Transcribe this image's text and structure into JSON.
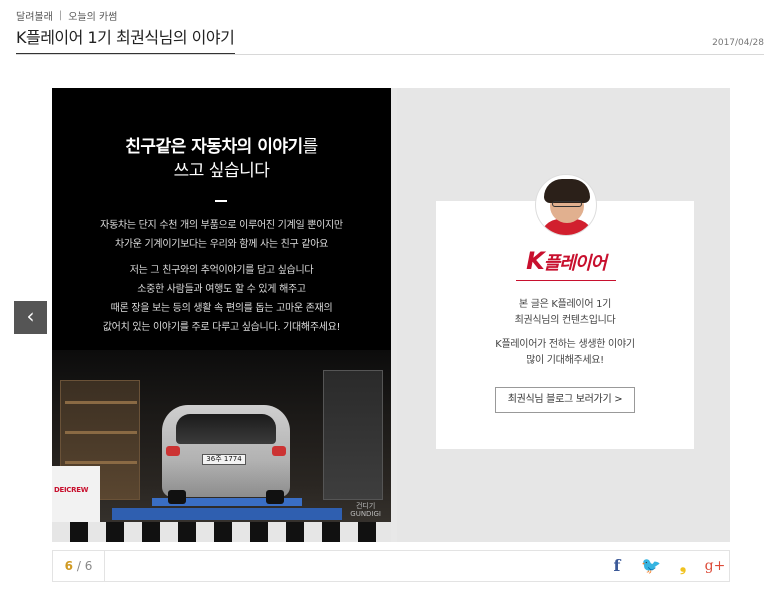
{
  "breadcrumb": {
    "parent": "달려볼래",
    "current": "오늘의 카썸"
  },
  "page_title": "K플레이어 1기 최권식님의 이야기",
  "date": "2017/04/28",
  "slide": {
    "headline_bold": "친구같은 자동차의 이야기",
    "headline_tail": "를",
    "headline_line2": "쓰고 싶습니다",
    "paragraph1": [
      "자동차는 단지 수천 개의 부품으로 이루어진 기계일 뿐이지만",
      "차가운 기계이기보다는 우리와 함께 사는 친구 같아요"
    ],
    "paragraph2": [
      "저는 그 친구와의 추억이야기를 담고 싶습니다",
      "소중한 사람들과 여행도 할 수 있게 해주고",
      "때론 장을 보는 등의 생활 속 편의를 돕는 고마운 존재의",
      "값어치 있는 이야기를 주로 다루고 싶습니다. 기대해주세요!"
    ],
    "photo": {
      "plate": "36주 1774",
      "banner": "DEICREW",
      "watermark_line1": "건디기",
      "watermark_line2": "GUNDIGI"
    }
  },
  "card": {
    "brand_k": "K",
    "brand_rest": "플레이어",
    "text1": [
      "본 글은 K플레이어 1기",
      "최권식님의 컨텐츠입니다"
    ],
    "text2": [
      "K플레이어가 전하는 생생한 이야기",
      "많이 기대해주세요!"
    ],
    "button_label": "최권식님 블로그 보러가기 >"
  },
  "nav": {
    "prev_icon": "chevron-left-icon",
    "prev_glyph": "‹"
  },
  "pager": {
    "current": "6",
    "total": "6"
  },
  "share": {
    "facebook": "f",
    "twitter": "🐦",
    "kakaostory": "❟",
    "googleplus": "g+"
  },
  "colors": {
    "accent_red": "#c8102e",
    "pager_current": "#d09a23",
    "facebook": "#3b5998",
    "twitter": "#1da1f2",
    "kakaostory": "#f0c21f",
    "googleplus": "#dd4b39"
  }
}
